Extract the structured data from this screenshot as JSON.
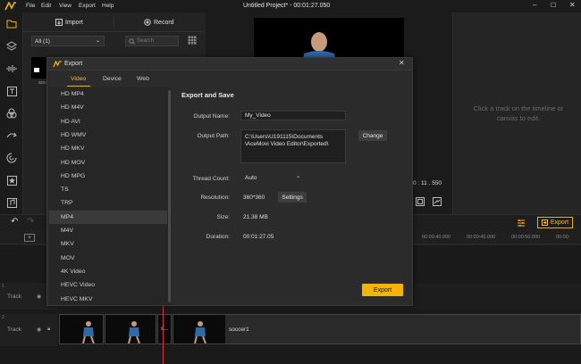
{
  "menu": [
    "File",
    "Edit",
    "View",
    "Export",
    "Help"
  ],
  "window_title": "Untitled Project* - 00:01:27.050",
  "media": {
    "import_label": "Import",
    "record_label": "Record",
    "filter_value": "All (1)",
    "search_placeholder": "Search",
    "thumb_label": "socc"
  },
  "preview": {
    "time": "0 : 11 . 550"
  },
  "props": {
    "hint": "Click a track on the timeline or canvas to edit."
  },
  "toolbar": {
    "export_label": "Export"
  },
  "timeline": {
    "ticks": [
      "00:00:40.000",
      "00:00:45.000",
      "00:00:50.000",
      "00:00:"
    ],
    "tracks": [
      {
        "num": "1",
        "label": "Track"
      },
      {
        "num": "2",
        "label": "Track"
      }
    ],
    "clip_label_short": "s...",
    "clip_label": "soccer1"
  },
  "dialog": {
    "title": "Export",
    "tabs": [
      "Video",
      "Device",
      "Web"
    ],
    "active_tab": "Video",
    "formats": [
      "HD MP4",
      "HD M4V",
      "HD AVI",
      "HD WMV",
      "HD MKV",
      "HD MOV",
      "HD MPG",
      "TS",
      "TRP",
      "MP4",
      "M4V",
      "MKV",
      "MOV",
      "4K Video",
      "HEVC Video",
      "HEVC MKV"
    ],
    "selected_format": "MP4",
    "heading": "Export and Save",
    "output_name_label": "Output Name:",
    "output_name": "My_Video",
    "output_path_label": "Output Path:",
    "output_path_line1": "C:\\Users\\U191115\\Documents",
    "output_path_line2": "\\AceMovi Video Editor\\Exported\\",
    "change_label": "Change",
    "thread_label": "Thread Count:",
    "thread_value": "Auto",
    "resolution_label": "Resolution:",
    "resolution_value": "360*360",
    "settings_label": "Settings",
    "size_label": "Size:",
    "size_value": "21.38 MB",
    "duration_label": "Duration:",
    "duration_value": "00:01:27.05",
    "export_label": "Export"
  },
  "colors": {
    "accent": "#f4b400",
    "background": "#232323",
    "dialog": "#2b2b2b"
  }
}
